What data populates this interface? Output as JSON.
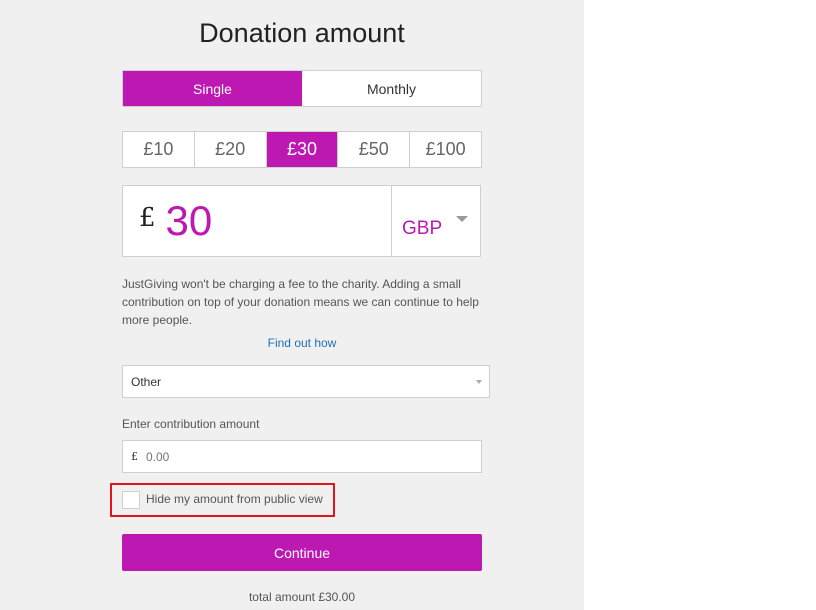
{
  "title": "Donation amount",
  "frequency": {
    "options": [
      {
        "label": "Single",
        "active": true
      },
      {
        "label": "Monthly",
        "active": false
      }
    ]
  },
  "preset_amounts": [
    {
      "label": "£10",
      "active": false
    },
    {
      "label": "£20",
      "active": false
    },
    {
      "label": "£30",
      "active": true
    },
    {
      "label": "£50",
      "active": false
    },
    {
      "label": "£100",
      "active": false
    }
  ],
  "amount_input": {
    "currency_symbol": "£",
    "value": "30",
    "currency_code": "GBP"
  },
  "fee_info": "JustGiving won't be charging a fee to the charity. Adding a small contribution on top of your donation means we can continue to help more people.",
  "find_out_link": "Find out how",
  "contribution_select": {
    "selected": "Other"
  },
  "contribution_label": "Enter contribution amount",
  "contribution_input": {
    "currency_symbol": "£",
    "placeholder": "0.00",
    "value": ""
  },
  "hide_amount": {
    "label": "Hide my amount from public view",
    "checked": false
  },
  "continue_label": "Continue",
  "total": "total amount £30.00",
  "colors": {
    "brand": "#bd18b2",
    "link": "#1f6fc0",
    "highlight": "#e0161e"
  }
}
